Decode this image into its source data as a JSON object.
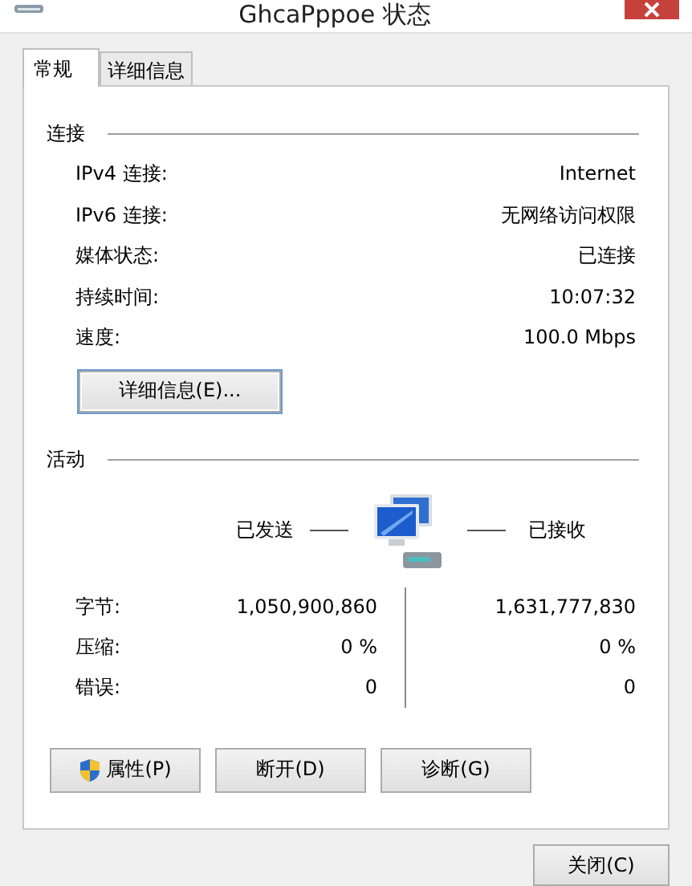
{
  "window": {
    "title": "GhcaPppoe 状态"
  },
  "tabs": [
    {
      "label": "常规",
      "selected": true
    },
    {
      "label": "详细信息",
      "selected": false
    }
  ],
  "connection": {
    "heading": "连接",
    "rows": [
      {
        "label": "IPv4 连接:",
        "value": "Internet"
      },
      {
        "label": "IPv6 连接:",
        "value": "无网络访问权限"
      },
      {
        "label": "媒体状态:",
        "value": "已连接"
      },
      {
        "label": "持续时间:",
        "value": "10:07:32"
      },
      {
        "label": "速度:",
        "value": "100.0 Mbps"
      }
    ],
    "details_button": "详细信息(E)..."
  },
  "activity": {
    "heading": "活动",
    "sent_label": "已发送",
    "received_label": "已接收",
    "rows": [
      {
        "label": "字节:",
        "sent": "1,050,900,860",
        "received": "1,631,777,830"
      },
      {
        "label": "压缩:",
        "sent": "0 %",
        "received": "0 %"
      },
      {
        "label": "错误:",
        "sent": "0",
        "received": "0"
      }
    ]
  },
  "buttons": [
    {
      "label": "属性(P)",
      "shield": true
    },
    {
      "label": "断开(D)",
      "shield": false
    },
    {
      "label": "诊断(G)",
      "shield": false
    }
  ],
  "close_button": "关闭(C)"
}
